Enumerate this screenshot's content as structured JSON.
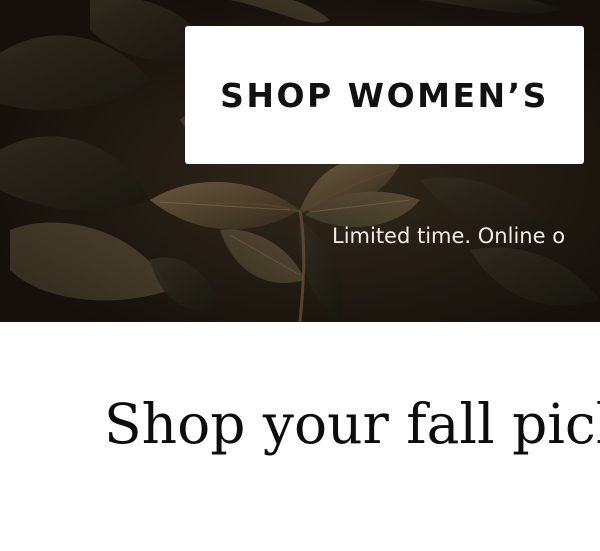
{
  "hero": {
    "shop_button_label": "SHOP WOMEN’S",
    "promo_text": "Limited time. Online o"
  },
  "section": {
    "heading": "Shop your fall picks"
  },
  "colors": {
    "hero_background": "#1a140d",
    "button_background": "#ffffff",
    "button_text": "#111111",
    "promo_text": "#f2ede4",
    "heading_text": "#0d0d0d"
  }
}
